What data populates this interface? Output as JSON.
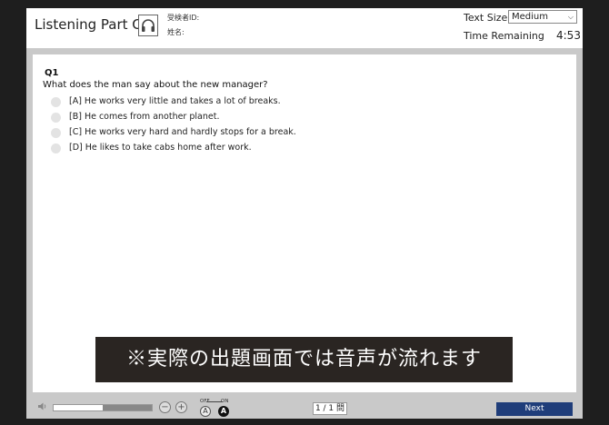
{
  "header": {
    "title": "Listening Part C",
    "examinee_id_label": "受検者ID:",
    "name_label": "姓名:",
    "text_size_label": "Text Size",
    "text_size_value": "Medium",
    "time_remaining_label": "Time Remaining",
    "time_remaining_value": "4:53"
  },
  "question": {
    "number": "Q1",
    "text": "What does the man say about the new manager?",
    "options": [
      {
        "label": "[A] He works very little and takes a lot of breaks."
      },
      {
        "label": "[B] He comes from another planet."
      },
      {
        "label": "[C] He works very hard and hardly stops for a break."
      },
      {
        "label": "[D] He likes to take cabs home after work."
      }
    ]
  },
  "banner": {
    "text": "※実際の出題画面では音声が流れます"
  },
  "footer": {
    "audio_progress": 0.5,
    "zoom_out_symbol": "−",
    "zoom_in_symbol": "+",
    "toggle_off_label": "OFF",
    "toggle_on_label": "ON",
    "toggle_a_off": "A",
    "toggle_a_on": "A",
    "pager": "1 / 1 問",
    "next_label": "Next"
  },
  "icons": {
    "headphone": "headphone-icon",
    "speaker": "speaker-icon",
    "select_chevron": "chevron-down-icon"
  }
}
